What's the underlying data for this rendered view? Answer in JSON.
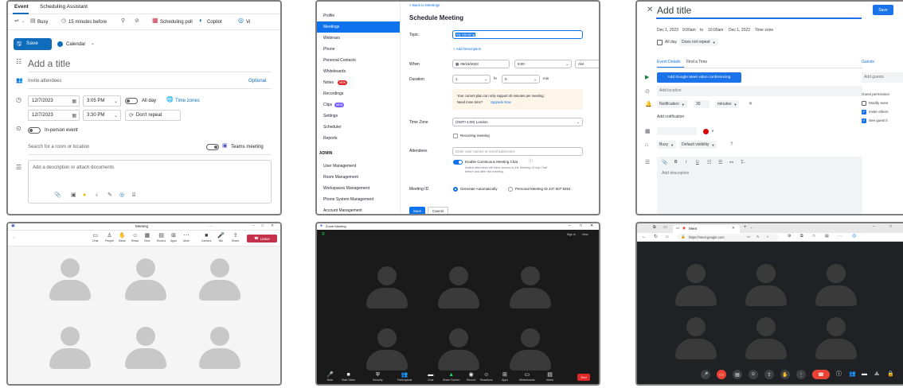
{
  "outlook": {
    "tabs": [
      "Event",
      "Scheduling Assistant"
    ],
    "toolbar": {
      "busy": "Busy",
      "reminder": "15 minutes before",
      "scheduling_poll": "Scheduling poll",
      "copilot": "Copilot",
      "view": "Vi"
    },
    "save": "Save",
    "calendar": "Calendar",
    "title_placeholder": "Add a title",
    "invite": "Invite attendees",
    "optional": "Optional",
    "start_date": "12/7/2023",
    "start_time": "3:05 PM",
    "end_date": "12/7/2023",
    "end_time": "3:30 PM",
    "all_day": "All day",
    "time_zones": "Time zones",
    "repeat": "Don't repeat",
    "in_person": "In-person event",
    "room_search": "Search for a room or location",
    "teams": "Teams meeting",
    "description": "Add a description or attach documents"
  },
  "zoom_schedule": {
    "back": "< Back to Meetings",
    "heading": "Schedule Meeting",
    "sidebar": [
      "Profile",
      "Meetings",
      "Webinars",
      "Phone",
      "Personal Contacts",
      "Whiteboards",
      "Notes",
      "Recordings",
      "Clips",
      "Settings",
      "Scheduler",
      "Reports"
    ],
    "badge_new": "NEW",
    "admin": "ADMIN",
    "admin_items": [
      "User Management",
      "Room Management",
      "Workspaces Management",
      "Phone System Management",
      "Account Management"
    ],
    "topic_label": "Topic",
    "topic_value": "My Meeting",
    "add_description": "+ Add Description",
    "when_label": "When",
    "date": "09/19/2023",
    "time": "9:00",
    "ampm": "AM",
    "duration_label": "Duration",
    "hours": "1",
    "hr": "hr",
    "minutes": "0",
    "min": "min",
    "notice": "Your current plan can only support 40 minutes per meeting.",
    "notice2": "Need more time?",
    "upgrade": "Upgrade Now",
    "tz_label": "Time Zone",
    "tz_value": "(GMT+1:00) London",
    "recurring": "Recurring meeting",
    "attendees_label": "Attendees",
    "attendees_placeholder": "Enter user names or email addresses",
    "chat": "Enable Continuous Meeting Chat",
    "chat_note": "Added attendees will have access to the Meeting Group Chat before and after the meeting.",
    "meeting_id_label": "Meeting ID",
    "generate": "Generate Automatically",
    "personal": "Personal Meeting ID 447 607 9254",
    "save": "Save",
    "cancel": "Cancel"
  },
  "gcal": {
    "title": "Add title",
    "save": "Save",
    "start_date": "Dec 1, 2023",
    "start_time": "9:00am",
    "to": "to",
    "end_time": "10:00am",
    "end_date": "Dec 1, 2023",
    "time_zone": "Time zone",
    "all_day": "All day",
    "repeat": "Does not repeat",
    "tab_details": "Event Details",
    "tab_find": "Find a Time",
    "meet_btn": "Add Google Meet video conferencing",
    "location": "Add location",
    "notification": "Notification",
    "notif_value": "30",
    "notif_unit": "minutes",
    "add_notification": "Add notification",
    "busy": "Busy",
    "visibility": "Default visibility",
    "description": "Add description",
    "guests": "Guests",
    "add_guests": "Add guests",
    "guest_permissions": "Guest permission",
    "perm1": "Modify even",
    "perm2": "Invite others",
    "perm3": "See guest li"
  },
  "teams_meeting": {
    "title": "Meeting",
    "timer": "",
    "items": [
      "Chat",
      "People",
      "Raise",
      "React",
      "View",
      "Rooms",
      "Apps",
      "More",
      "Camera",
      "Mic",
      "Share"
    ],
    "leave": "Leave"
  },
  "zoom_meeting": {
    "title": "Zoom Meeting",
    "top_right": "Sign in",
    "view": "View",
    "items": [
      "Mute",
      "Start Video",
      "Security",
      "Participants",
      "Chat",
      "Share Screen",
      "Record",
      "Reactions",
      "Apps",
      "Whiteboards",
      "Notes"
    ],
    "end": "End"
  },
  "meet": {
    "tab_title": "Meet",
    "url": "https://meet.google.com"
  }
}
